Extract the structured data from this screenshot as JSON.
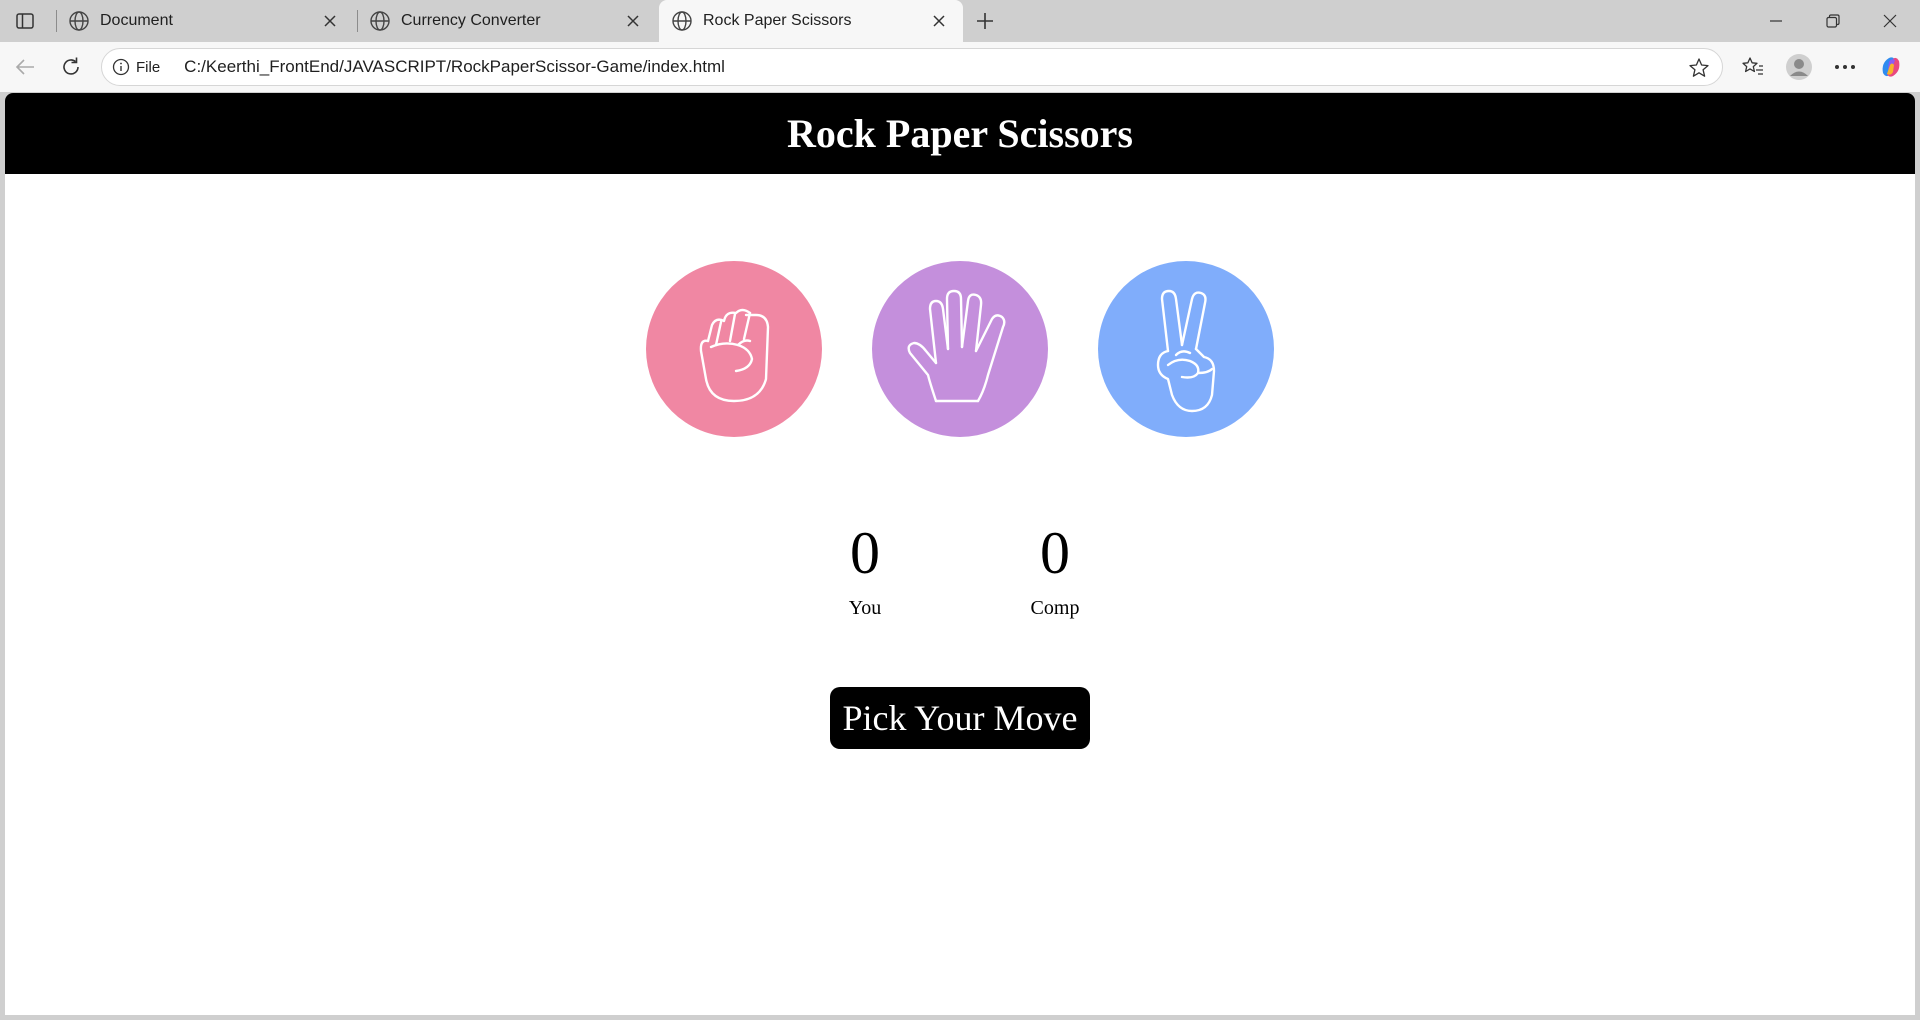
{
  "browser": {
    "tabs": [
      {
        "label": "Document",
        "active": false
      },
      {
        "label": "Currency Converter",
        "active": false
      },
      {
        "label": "Rock Paper Scissors",
        "active": true
      }
    ],
    "address": {
      "scheme_label": "File",
      "url": "C:/Keerthi_FrontEnd/JAVASCRIPT/RockPaperScissor-Game/index.html"
    }
  },
  "page": {
    "title": "Rock Paper Scissors",
    "choices": [
      {
        "id": "rock",
        "icon": "rock-hand-icon",
        "color": "#f087a3"
      },
      {
        "id": "paper",
        "icon": "paper-hand-icon",
        "color": "#c48fdc"
      },
      {
        "id": "scissors",
        "icon": "scissors-hand-icon",
        "color": "#80adfb"
      }
    ],
    "scores": {
      "user": {
        "value": "0",
        "label": "You"
      },
      "comp": {
        "value": "0",
        "label": "Comp"
      }
    },
    "message": "Pick Your Move"
  }
}
